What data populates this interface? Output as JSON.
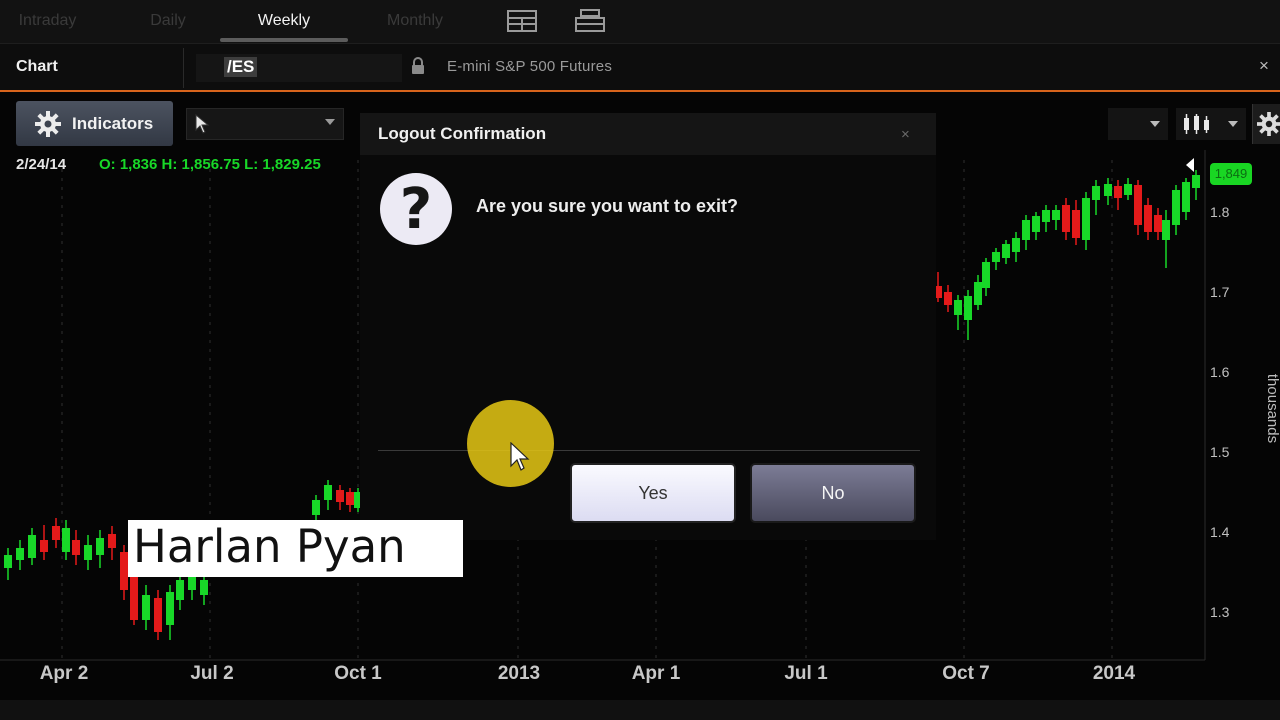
{
  "period_tabs": [
    {
      "label": "Intraday",
      "active": false
    },
    {
      "label": "Daily",
      "active": false
    },
    {
      "label": "Weekly",
      "active": true
    },
    {
      "label": "Monthly",
      "active": false
    }
  ],
  "toolbar_icons": [
    "layout-grid-icon",
    "window-icon"
  ],
  "chart_header": {
    "title": "Chart",
    "symbol": "/ES",
    "description": "E-mini S&P 500 Futures",
    "close_glyph": "×"
  },
  "toolbar": {
    "indicators_label": "Indicators",
    "cursor_mode": "pointer"
  },
  "ohlc": {
    "date": "2/24/14",
    "values": "O: 1,836 H: 1,856.75 L: 1,829.25"
  },
  "chart": {
    "x_labels": [
      "Apr 2",
      "Jul 2",
      "Oct 1",
      "2013",
      "Apr 1",
      "Jul 1",
      "Oct 7",
      "2014"
    ],
    "y_labels": [
      "1.8",
      "1.7",
      "1.6",
      "1.5",
      "1.4",
      "1.3"
    ],
    "units": "thousands",
    "last_price": "1,849",
    "up_color": "#18d828",
    "down_color": "#e41a1a"
  },
  "dialog": {
    "title": "Logout Confirmation",
    "close_glyph": "×",
    "icon_glyph": "?",
    "message": "Are you sure you want to exit?",
    "yes_label": "Yes",
    "no_label": "No"
  },
  "caption": "Harlan Pyan"
}
